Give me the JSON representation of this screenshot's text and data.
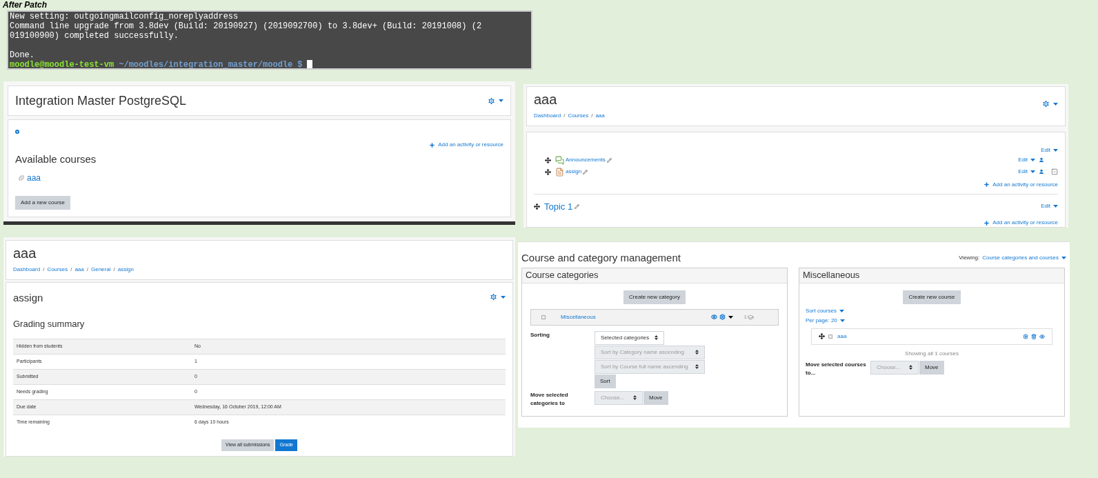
{
  "caption": "After Patch",
  "terminal": {
    "lines": [
      "New setting: outgoingmailconfig_noreplyaddress",
      "Command line upgrade from 3.8dev (Build: 20190927) (2019092700) to 3.8dev+ (Build: 20191008) (2",
      "019100900) completed successfully."
    ],
    "done": "Done.",
    "prompt": {
      "user": "moodle@moodle-test-vm",
      "path": "~/moodles/integration_master/moodle",
      "symbol": "$"
    }
  },
  "site_panel": {
    "title": "Integration Master PostgreSQL",
    "add_activity": "Add an activity or resource",
    "heading": "Available courses",
    "courses": [
      "aaa"
    ],
    "button": "Add a new course"
  },
  "course_panel": {
    "title": "aaa",
    "breadcrumb_separator": "/",
    "breadcrumb": [
      "Dashboard",
      "Courses",
      "aaa"
    ],
    "section_edit": "Edit",
    "activities": [
      {
        "kind": "forum",
        "name": "Announcements",
        "edit": "Edit",
        "completion": false
      },
      {
        "kind": "assign",
        "name": "assign",
        "edit": "Edit",
        "completion": true
      }
    ],
    "add_activity": "Add an activity or resource",
    "topic": {
      "title": "Topic 1",
      "edit": "Edit",
      "add_activity": "Add an activity or resource"
    }
  },
  "assign_panel": {
    "title": "aaa",
    "breadcrumb_separator": "/",
    "breadcrumb": [
      "Dashboard",
      "Courses",
      "aaa",
      "General",
      "assign"
    ],
    "heading": "assign",
    "summary_title": "Grading summary",
    "rows": [
      {
        "label": "Hidden from students",
        "value": "No"
      },
      {
        "label": "Participants",
        "value": "1"
      },
      {
        "label": "Submitted",
        "value": "0"
      },
      {
        "label": "Needs grading",
        "value": "0"
      },
      {
        "label": "Due date",
        "value": "Wednesday, 16 October 2019, 12:00 AM"
      },
      {
        "label": "Time remaining",
        "value": "6 days 10 hours"
      }
    ],
    "buttons": [
      {
        "kind": "secondary",
        "label": "View all submissions"
      },
      {
        "kind": "primary",
        "label": "Grade"
      }
    ]
  },
  "management": {
    "title": "Course and category management",
    "viewing_label": "Viewing:",
    "viewing_value": "Course categories and courses",
    "categories": {
      "title": "Course categories",
      "create": "Create new category",
      "items": [
        {
          "name": "Miscellaneous",
          "count": "1",
          "checked": false
        }
      ],
      "sorting_label": "Sorting",
      "sort_select": {
        "label": "Selected categories",
        "disabled": false
      },
      "sort_options": [
        {
          "label": "Sort by Category name ascending",
          "disabled": true
        },
        {
          "label": "Sort by Course full name ascending",
          "disabled": true
        }
      ],
      "sort_button": "Sort",
      "move_label": "Move selected categories to",
      "move_select": {
        "label": "Choose...",
        "disabled": true
      },
      "move_button": "Move"
    },
    "courses": {
      "title": "Miscellaneous",
      "create": "Create new course",
      "sort_link": "Sort courses",
      "per_page": "Per page: 20",
      "items": [
        {
          "name": "aaa",
          "checked": false
        }
      ],
      "showing": "Showing all 1 courses",
      "move_label": "Move selected courses to...",
      "move_select": {
        "label": "Choose...",
        "disabled": true
      },
      "move_button": "Move"
    }
  }
}
